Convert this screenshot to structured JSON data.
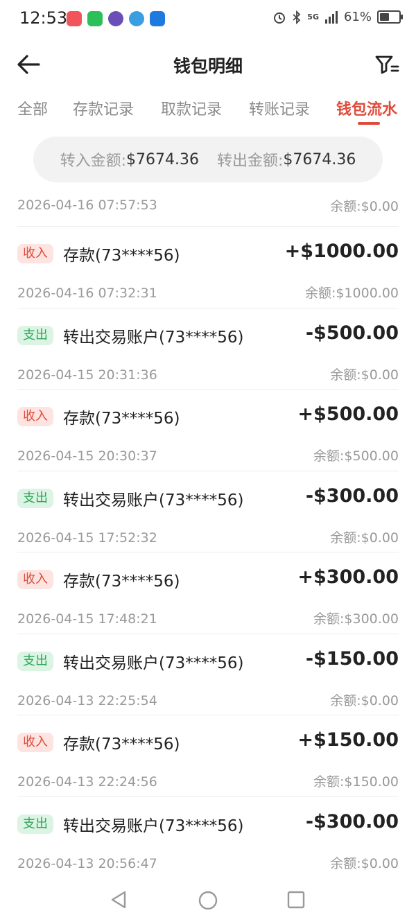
{
  "status": {
    "time": "12:53",
    "signal": "5G",
    "battery": "61%",
    "battery_level": 0.61
  },
  "header": {
    "title": "钱包明细"
  },
  "tabs": [
    {
      "label": "全部"
    },
    {
      "label": "存款记录"
    },
    {
      "label": "取款记录"
    },
    {
      "label": "转账记录"
    },
    {
      "label": "钱包流水",
      "active": true
    }
  ],
  "summary": {
    "in_label": "转入金额:",
    "in_value": "$7674.36",
    "out_label": "转出金额:",
    "out_value": "$7674.36"
  },
  "partial_row": {
    "date": "2026-04-16 07:57:53",
    "balance": "余额:$0.00"
  },
  "transactions": [
    {
      "type": "收入",
      "kind": "in",
      "desc": "存款(73****56)",
      "amount": "+$1000.00",
      "date": "2026-04-16 07:32:31",
      "balance": "余额:$1000.00"
    },
    {
      "type": "支出",
      "kind": "out",
      "desc": "转出交易账户(73****56)",
      "amount": "-$500.00",
      "date": "2026-04-15 20:31:36",
      "balance": "余额:$0.00"
    },
    {
      "type": "收入",
      "kind": "in",
      "desc": "存款(73****56)",
      "amount": "+$500.00",
      "date": "2026-04-15 20:30:37",
      "balance": "余额:$500.00"
    },
    {
      "type": "支出",
      "kind": "out",
      "desc": "转出交易账户(73****56)",
      "amount": "-$300.00",
      "date": "2026-04-15 17:52:32",
      "balance": "余额:$0.00"
    },
    {
      "type": "收入",
      "kind": "in",
      "desc": "存款(73****56)",
      "amount": "+$300.00",
      "date": "2026-04-15 17:48:21",
      "balance": "余额:$300.00"
    },
    {
      "type": "支出",
      "kind": "out",
      "desc": "转出交易账户(73****56)",
      "amount": "-$150.00",
      "date": "2026-04-13 22:25:54",
      "balance": "余额:$0.00"
    },
    {
      "type": "收入",
      "kind": "in",
      "desc": "存款(73****56)",
      "amount": "+$150.00",
      "date": "2026-04-13 22:24:56",
      "balance": "余额:$150.00"
    },
    {
      "type": "支出",
      "kind": "out",
      "desc": "转出交易账户(73****56)",
      "amount": "-$300.00",
      "date": "2026-04-13 20:56:47",
      "balance": "余额:$0.00"
    }
  ],
  "colors": {
    "accent": "#e04a3a",
    "income_badge_bg": "#fde4e1",
    "expense_text": "#2fa55a",
    "expense_badge_bg": "#dcf4e3"
  },
  "icons": {
    "back": "arrow-left-icon",
    "filter": "filter-list-icon",
    "nav_back": "triangle-back-icon",
    "nav_home": "circle-home-icon",
    "nav_recent": "square-recent-icon"
  }
}
